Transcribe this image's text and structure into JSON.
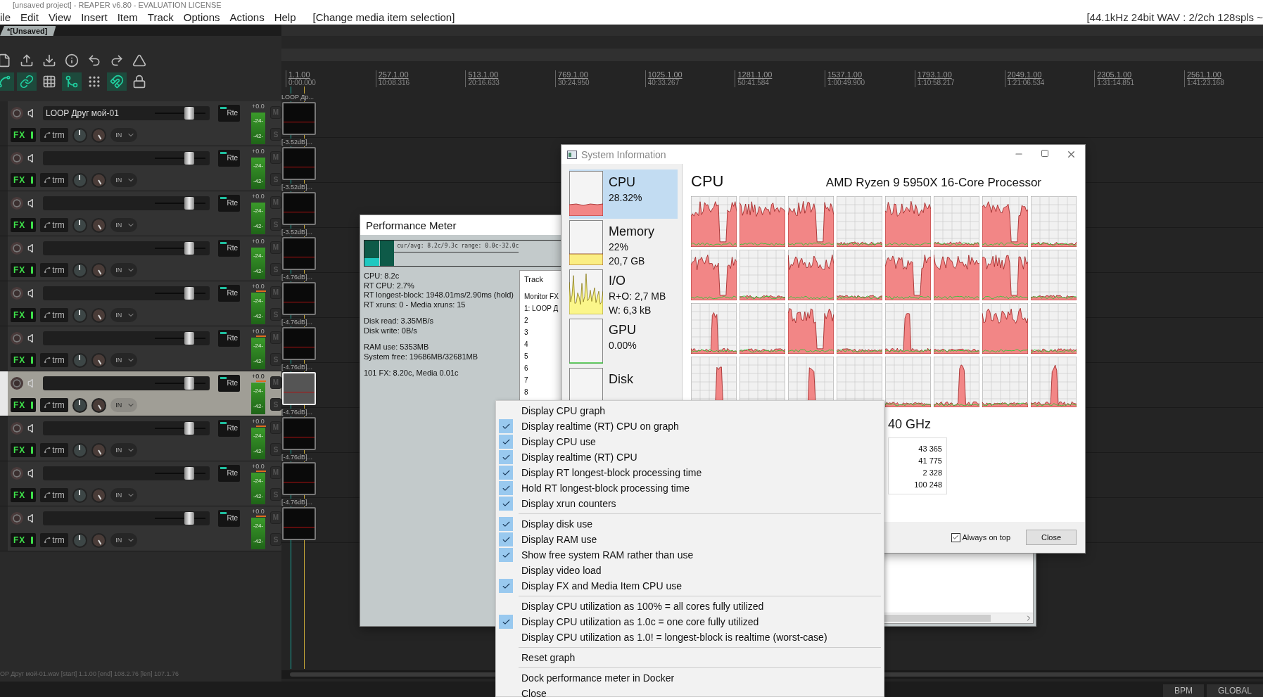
{
  "app_title": "[unsaved project] - REAPER v6.80 - EVALUATION LICENSE",
  "menu": [
    "ile",
    "Edit",
    "View",
    "Insert",
    "Item",
    "Track",
    "Options",
    "Actions",
    "Help"
  ],
  "action_hint": "[Change media item selection]",
  "audio_status": "[44.1kHz 24bit WAV : 2/2ch 128spls ~",
  "project_tab": {
    "label": "*[Unsaved]",
    "selected": true
  },
  "ruler": [
    {
      "bar": "1.1.00",
      "time": "0:00.000"
    },
    {
      "bar": "257.1.00",
      "time": "10:08.316"
    },
    {
      "bar": "513.1.00",
      "time": "20:16.633"
    },
    {
      "bar": "769.1.00",
      "time": "30:24.950"
    },
    {
      "bar": "1025.1.00",
      "time": "40:33.267"
    },
    {
      "bar": "1281.1.00",
      "time": "50:41.584"
    },
    {
      "bar": "1537.1.00",
      "time": "1:00:49.900"
    },
    {
      "bar": "1793.1.00",
      "time": "1:10:58.217"
    },
    {
      "bar": "2049.1.00",
      "time": "1:21:06.534"
    },
    {
      "bar": "2305.1.00",
      "time": "1:31:14.851"
    },
    {
      "bar": "2561.1.00",
      "time": "1:41:23.168"
    }
  ],
  "tracks": [
    {
      "name": "LOOP Друг мой-01",
      "selected": false,
      "peak": false,
      "readout": "+0.0",
      "scale": [
        "-24-",
        "-42-"
      ],
      "item_label": "LOOP Др...",
      "fx": "FX",
      "trim": "trm",
      "input": "IN",
      "route": "Rte",
      "mute": "M",
      "solo": "S"
    },
    {
      "selected": false,
      "peak": false,
      "readout": "+0.0",
      "scale": [
        "-24-",
        "-42-"
      ],
      "item_label": "[-3.52dB]...",
      "fx": "FX",
      "trim": "trm",
      "input": "IN",
      "route": "Rte",
      "mute": "M",
      "solo": "S"
    },
    {
      "selected": false,
      "peak": false,
      "readout": "+0.0",
      "scale": [
        "-24-",
        "-42-"
      ],
      "item_label": "[-3.52dB]...",
      "fx": "FX",
      "trim": "trm",
      "input": "IN",
      "route": "Rte",
      "mute": "M",
      "solo": "S"
    },
    {
      "selected": false,
      "peak": false,
      "readout": "+0.0",
      "scale": [
        "-24-",
        "-42-"
      ],
      "item_label": "[-3.52dB]...",
      "fx": "FX",
      "trim": "trm",
      "input": "IN",
      "route": "Rte",
      "mute": "M",
      "solo": "S"
    },
    {
      "selected": false,
      "peak": true,
      "readout": "+0.0",
      "scale": [
        "-24-",
        "-42-"
      ],
      "item_label": "[-4.76dB]...",
      "fx": "FX",
      "trim": "trm",
      "input": "IN",
      "route": "Rte",
      "mute": "M",
      "solo": "S"
    },
    {
      "selected": false,
      "peak": true,
      "readout": "+0.0",
      "scale": [
        "-24-",
        "-42-"
      ],
      "item_label": "[-4.76dB]...",
      "fx": "FX",
      "trim": "trm",
      "input": "IN",
      "route": "Rte",
      "mute": "M",
      "solo": "S"
    },
    {
      "selected": true,
      "peak": true,
      "readout": "+0.0",
      "scale": [
        "-24-",
        "-42-"
      ],
      "item_label": "[-4.76dB]...",
      "fx": "FX",
      "trim": "trm",
      "input": "IN",
      "route": "Rte",
      "mute": "M",
      "solo": "S"
    },
    {
      "selected": false,
      "peak": true,
      "readout": "+0.0",
      "scale": [
        "-24-",
        "-42-"
      ],
      "item_label": "[-4.76dB]...",
      "fx": "FX",
      "trim": "trm",
      "input": "IN",
      "route": "Rte",
      "mute": "M",
      "solo": "S"
    },
    {
      "selected": false,
      "peak": true,
      "readout": "+0.0",
      "scale": [
        "-24-",
        "-42-"
      ],
      "item_label": "[-4.76dB]...",
      "fx": "FX",
      "trim": "trm",
      "input": "IN",
      "route": "Rte",
      "mute": "M",
      "solo": "S"
    },
    {
      "selected": false,
      "peak": true,
      "readout": "+0.0",
      "scale": [
        "-24-",
        "-42-"
      ],
      "item_label": "[-4.76dB]...",
      "fx": "FX",
      "trim": "trm",
      "input": "IN",
      "route": "Rte",
      "mute": "M",
      "solo": "S"
    }
  ],
  "status_line": "OP Друг мой-01.wav [start] 1.1.00 [end] 108.2.76 [len] 107.1.76",
  "transport": {
    "bpm_label": "BPM",
    "global_label": "GLOBAL"
  },
  "perf_meter": {
    "title": "Performance Meter",
    "graph_caption": "cur/avg: 8.2c/9.3c  range: 0.0c-32.0c",
    "stats": [
      [
        "CPU: 8.2c",
        "RT CPU: 2.7%",
        "RT longest-block: 1948.01ms/2.90ms (hold)",
        "RT xruns: 0 - Media xruns: 15"
      ],
      [
        "Disk read: 3.35MB/s",
        "Disk write: 0B/s"
      ],
      [
        "RAM use: 5353MB",
        "System free: 19686MB/32681MB"
      ],
      [
        "101 FX: 8.20c, Media 0.01c"
      ]
    ],
    "list_header": "Track",
    "list_rows": [
      "Monitor FX",
      "1: LOOP Д",
      "2",
      "3",
      "4",
      "5",
      "6",
      "7",
      "8"
    ]
  },
  "sys_info": {
    "title": "System Information",
    "sidebar": [
      {
        "kind": "cpu",
        "label": "CPU",
        "values": [
          "28.32%"
        ],
        "selected": true
      },
      {
        "kind": "memory",
        "label": "Memory",
        "values": [
          "22%",
          "20,7 GB"
        ],
        "selected": false
      },
      {
        "kind": "io",
        "label": "I/O",
        "values": [
          "R+O: 2,7 MB",
          "W: 6,3 kB"
        ],
        "selected": false
      },
      {
        "kind": "gpu",
        "label": "GPU",
        "values": [
          "0.00%"
        ],
        "selected": false
      },
      {
        "kind": "disk",
        "label": "Disk",
        "selected": false
      }
    ],
    "heading": "CPU",
    "processor": "AMD Ryzen 9 5950X 16-Core Processor",
    "speed": "40 GHz",
    "stats": [
      "43 365",
      "41 775",
      "2 328",
      "100 248"
    ],
    "always_on_top": {
      "label": "Always on top",
      "checked": true
    },
    "close_button": "Close"
  },
  "context_menu": {
    "groups": [
      [
        {
          "label": "Display CPU graph",
          "checked": false
        },
        {
          "label": "Display realtime (RT) CPU on graph",
          "checked": true
        },
        {
          "label": "Display CPU use",
          "checked": true
        },
        {
          "label": "Display realtime (RT) CPU",
          "checked": true
        },
        {
          "label": "Display RT longest-block processing time",
          "checked": true
        },
        {
          "label": "Hold RT longest-block processing time",
          "checked": true
        },
        {
          "label": "Display xrun counters",
          "checked": true
        }
      ],
      [
        {
          "label": "Display disk use",
          "checked": true
        },
        {
          "label": "Display RAM use",
          "checked": true
        },
        {
          "label": "Show free system RAM rather than use",
          "checked": true
        },
        {
          "label": "Display video load",
          "checked": false
        },
        {
          "label": "Display FX and Media Item CPU use",
          "checked": true
        }
      ],
      [
        {
          "label": "Display CPU utilization as 100% = all cores fully utilized",
          "checked": false
        },
        {
          "label": "Display CPU utilization as 1.0c = one core fully utilized",
          "checked": true
        },
        {
          "label": "Display CPU utilization as 1.0! = longest-block is realtime (worst-case)",
          "checked": false
        }
      ],
      [
        {
          "label": "Reset graph",
          "checked": false
        }
      ],
      [
        {
          "label": "Dock performance meter in Docker",
          "checked": false
        },
        {
          "label": "Close",
          "checked": false
        }
      ]
    ]
  }
}
